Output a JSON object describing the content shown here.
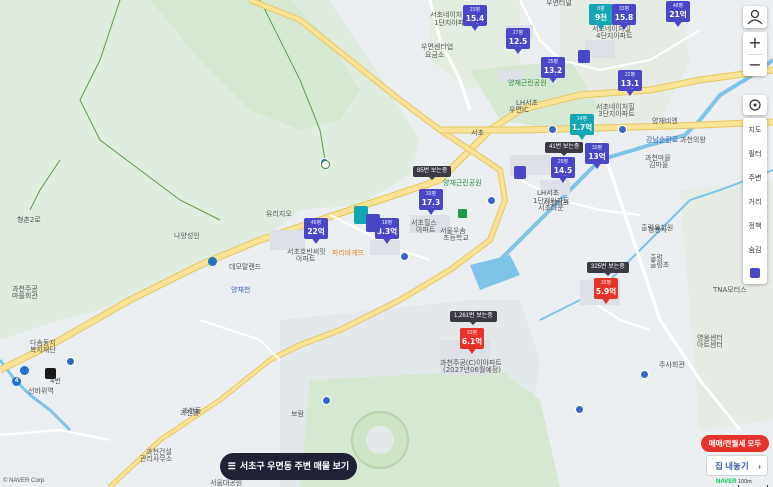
{
  "colors": {
    "background": "#eceff1",
    "park": "#d5e8cf",
    "road_major": "#f7e497",
    "road_major_edge": "#e6c75f",
    "water": "#7ec4e8",
    "listing_blue": "#4a46c8",
    "listing_teal": "#15a6b3",
    "listing_red": "#e5332a"
  },
  "map_labels": {
    "l1": "우면센터업",
    "l2": "요금소",
    "l3": "서초네이처힐",
    "l4": "1단지아파트",
    "l5": "서초네이처힐",
    "l6": "4단지아파트",
    "l7": "서초네이처힐",
    "l8": "3단지아파트",
    "l9": "양재근린공원",
    "l10": "서초",
    "l11": "강남순환로",
    "l12": "과천의왕",
    "l13": "과천마을",
    "l14": "김마을",
    "l15": "양재근린공원",
    "l16": "LH서초",
    "l17": "1단지아파트",
    "l18": "유리지오",
    "l19": "서초호반써밋",
    "l20": "아파트",
    "l21": "데모랄랜드",
    "l22": "서초힐스",
    "l23": "아파트",
    "l24": "서울우솜",
    "l25": "초등학교",
    "l26": "양재천",
    "l27": "파리바게뜨",
    "l28": "형촌2로",
    "l29": "과천동",
    "l30": "청룡사",
    "l31": "출렁",
    "l32": "과천주공",
    "l33": "마을회관",
    "l34": "다솜동지",
    "l35": "복지재단",
    "l36": "과천주공(C)이아파트",
    "l37": "(2027년06월예정)",
    "l38": "과천동",
    "l39": "보람",
    "l40": "과천건설",
    "l41": "관리사무소",
    "l42": "서울대공원",
    "l43": "출렁유치원",
    "l44": "주사회관",
    "l45": "영웅센터",
    "l46": "아트센터",
    "l47": "TNA모터스",
    "l48": "서초테크",
    "l49": "4번",
    "l50": "우면터널",
    "l51": "LH서초",
    "l52": "서초타운",
    "l53": "양재비엔",
    "l54": "나양성인",
    "l55": "선바위역",
    "l56": "출렁초",
    "l57": "우면IC"
  },
  "listings": [
    {
      "id": "m1",
      "small": "23평",
      "price": "15.4억",
      "style": "blue"
    },
    {
      "id": "m2",
      "small": "27평",
      "price": "12.5억",
      "style": "blue"
    },
    {
      "id": "m3",
      "small": "25평",
      "price": "13.2억",
      "style": "blue"
    },
    {
      "id": "m4",
      "small": "8평",
      "price": "9천",
      "style": "teal"
    },
    {
      "id": "m5",
      "small": "33평",
      "price": "15.8억",
      "style": "blue"
    },
    {
      "id": "m6",
      "small": "48평",
      "price": "21억",
      "style": "blue"
    },
    {
      "id": "m7",
      "small": "22평",
      "price": "13.1억",
      "style": "blue"
    },
    {
      "id": "m8",
      "small": "14평",
      "price": "1.7억",
      "style": "teal"
    },
    {
      "id": "m9",
      "small": "33평",
      "price": "13억",
      "style": "blue"
    },
    {
      "id": "m10",
      "small": "29평",
      "price": "14.5억",
      "style": "blue"
    },
    {
      "id": "m11",
      "small": "33평",
      "price": "17.3억",
      "style": "blue"
    },
    {
      "id": "m12",
      "small": "45평",
      "price": "22억",
      "style": "blue"
    },
    {
      "id": "m13",
      "small": "18평",
      "price": "3.3억",
      "style": "blue"
    },
    {
      "id": "m14",
      "small": "32평",
      "price": "5.9억",
      "style": "red"
    },
    {
      "id": "m15",
      "small": "33평",
      "price": "6.1억",
      "style": "red"
    }
  ],
  "tags": {
    "t1": "41번 보는중",
    "t2": "85번 보는중",
    "t3": "325번 보는중",
    "t4": "1,261번 보는중"
  },
  "controls": {
    "zoom_in": "+",
    "zoom_out": "−",
    "layers": [
      {
        "label": "지도"
      },
      {
        "label": "필터"
      },
      {
        "label": "주변"
      },
      {
        "label": "거리"
      },
      {
        "label": "정책"
      },
      {
        "label": "숨김"
      }
    ]
  },
  "bottom": {
    "search_area_button": "서초구 우면동 주변 매물 보기",
    "filter_pill": "매매/전월세 모두",
    "listing_button": "집 내놓기",
    "copyright": "© NAVER Corp.",
    "brand": "NAVER",
    "scale": "100m"
  },
  "stations": {
    "s1": "4"
  }
}
